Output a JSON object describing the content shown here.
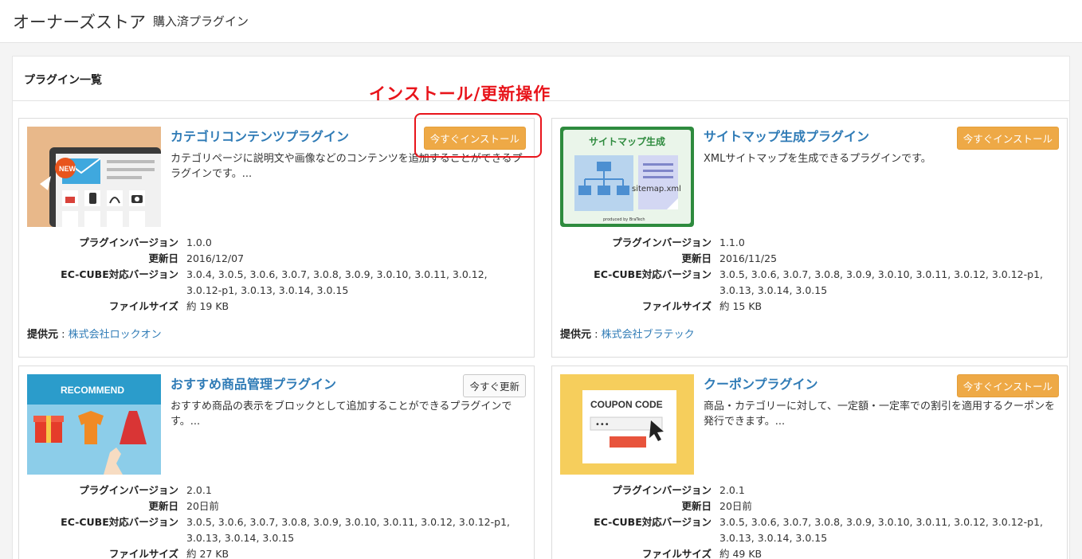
{
  "header": {
    "title": "オーナーズストア",
    "subtitle": "購入済プラグイン"
  },
  "panel": {
    "title": "プラグイン一覧"
  },
  "annotation": {
    "text": "インストール/更新操作",
    "color": "#e8141b"
  },
  "labels": {
    "version": "プラグインバージョン",
    "updated": "更新日",
    "compat": "EC-CUBE対応バージョン",
    "filesize": "ファイルサイズ",
    "provider": "提供元",
    "provider_sep": " : "
  },
  "plugins": [
    {
      "name": "カテゴリコンテンツプラグイン",
      "button": "今すぐインストール",
      "button_type": "install",
      "description": "カテゴリページに説明文や画像などのコンテンツを追加することができるプラグインです。...",
      "version": "1.0.0",
      "updated": "2016/12/07",
      "compat": "3.0.4, 3.0.5, 3.0.6, 3.0.7, 3.0.8, 3.0.9, 3.0.10, 3.0.11, 3.0.12, 3.0.12-p1, 3.0.13, 3.0.14, 3.0.15",
      "filesize": "約 19 KB",
      "provider": "株式会社ロックオン",
      "thumb": "category-contents-thumbnail"
    },
    {
      "name": "サイトマップ生成プラグイン",
      "button": "今すぐインストール",
      "button_type": "install",
      "description": "XMLサイトマップを生成できるプラグインです。",
      "version": "1.1.0",
      "updated": "2016/11/25",
      "compat": "3.0.5, 3.0.6, 3.0.7, 3.0.8, 3.0.9, 3.0.10, 3.0.11, 3.0.12, 3.0.12-p1, 3.0.13, 3.0.14, 3.0.15",
      "filesize": "約 15 KB",
      "provider": "株式会社ブラテック",
      "thumb": "sitemap-thumbnail",
      "thumb_text": {
        "heading": "サイトマップ生成",
        "file": "sitemap.xml",
        "credit": "produced by BraTech"
      }
    },
    {
      "name": "おすすめ商品管理プラグイン",
      "button": "今すぐ更新",
      "button_type": "update",
      "description": "おすすめ商品の表示をブロックとして追加することができるプラグインです。...",
      "version": "2.0.1",
      "updated": "20日前",
      "compat": "3.0.5, 3.0.6, 3.0.7, 3.0.8, 3.0.9, 3.0.10, 3.0.11, 3.0.12, 3.0.12-p1, 3.0.13, 3.0.14, 3.0.15",
      "filesize": "約 27 KB",
      "thumb": "recommend-thumbnail",
      "thumb_text": {
        "heading": "RECOMMEND"
      }
    },
    {
      "name": "クーポンプラグイン",
      "button": "今すぐインストール",
      "button_type": "install",
      "description": "商品・カテゴリーに対して、一定額・一定率での割引を適用するクーポンを発行できます。...",
      "version": "2.0.1",
      "updated": "20日前",
      "compat": "3.0.5, 3.0.6, 3.0.7, 3.0.8, 3.0.9, 3.0.10, 3.0.11, 3.0.12, 3.0.12-p1, 3.0.13, 3.0.14, 3.0.15",
      "filesize": "約 49 KB",
      "thumb": "coupon-thumbnail",
      "thumb_text": {
        "heading": "COUPON CODE",
        "dots": "•••"
      }
    }
  ],
  "colors": {
    "link": "#2f7bb6",
    "install_button": "#eea946",
    "annotation": "#e8141b"
  }
}
